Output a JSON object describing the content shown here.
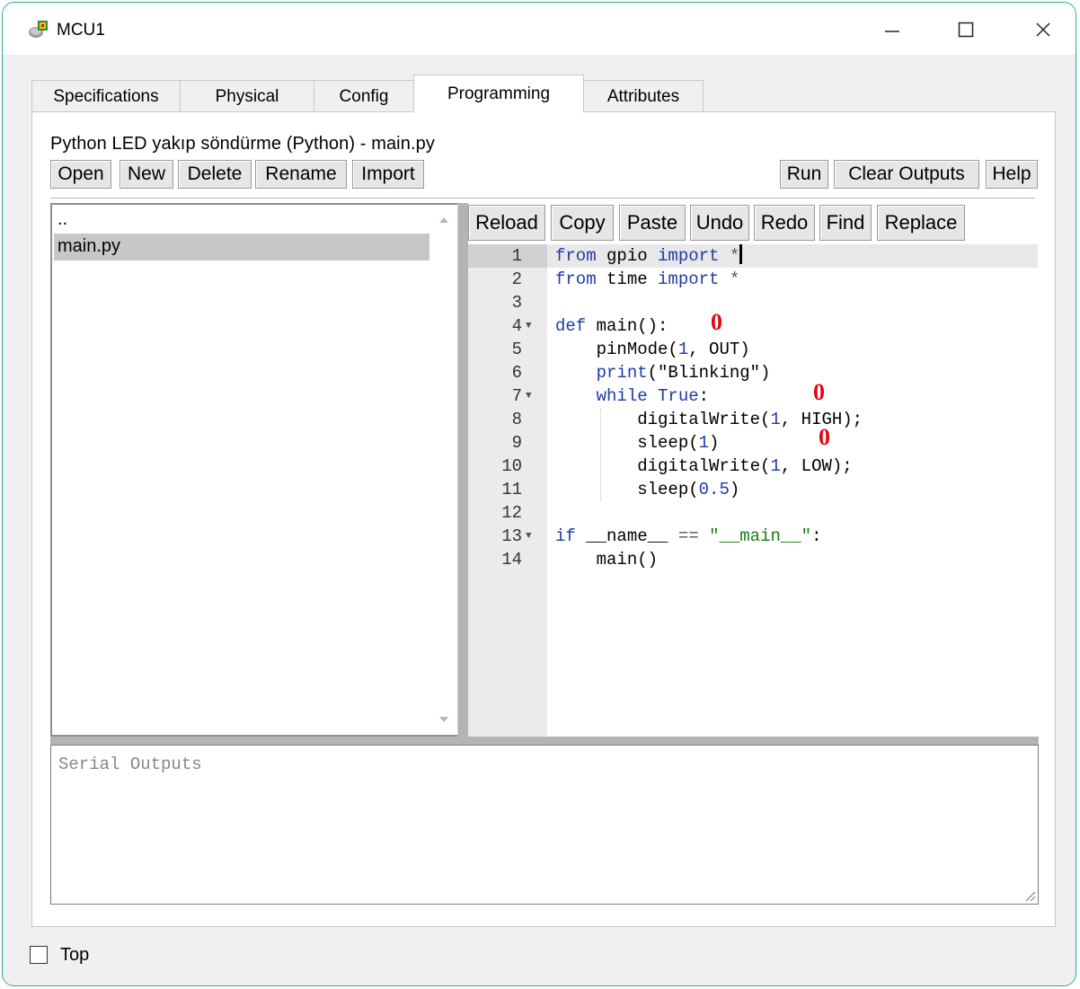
{
  "window": {
    "title": "MCU1",
    "icon": "mcu-device-icon",
    "controls": [
      "minimize-icon",
      "maximize-icon",
      "close-icon"
    ]
  },
  "tabs": [
    {
      "label": "Specifications",
      "active": false
    },
    {
      "label": "Physical",
      "active": false
    },
    {
      "label": "Config",
      "active": false
    },
    {
      "label": "Programming",
      "active": true
    },
    {
      "label": "Attributes",
      "active": false
    }
  ],
  "programming": {
    "file_title": "Python LED yakıp söndürme (Python) - main.py",
    "file_toolbar": [
      "Open",
      "New",
      "Delete",
      "Rename",
      "Import"
    ],
    "run_toolbar": [
      "Run",
      "Clear Outputs",
      "Help"
    ],
    "files": [
      {
        "name": "..",
        "selected": false
      },
      {
        "name": "main.py",
        "selected": true
      }
    ],
    "editor_toolbar": [
      "Reload",
      "Copy",
      "Paste",
      "Undo",
      "Redo",
      "Find",
      "Replace"
    ],
    "code_lines": [
      {
        "n": "1",
        "text": "from gpio import *"
      },
      {
        "n": "2",
        "text": "from time import *"
      },
      {
        "n": "3",
        "text": ""
      },
      {
        "n": "4",
        "text": "def main():"
      },
      {
        "n": "5",
        "text": "    pinMode(1, OUT)"
      },
      {
        "n": "6",
        "text": "    print(\"Blinking\")"
      },
      {
        "n": "7",
        "text": "    while True:"
      },
      {
        "n": "8",
        "text": "        digitalWrite(1, HIGH);"
      },
      {
        "n": "9",
        "text": "        sleep(1)"
      },
      {
        "n": "10",
        "text": "        digitalWrite(1, LOW);"
      },
      {
        "n": "11",
        "text": "        sleep(0.5)"
      },
      {
        "n": "12",
        "text": ""
      },
      {
        "n": "13",
        "text": "if __name__ == \"__main__\":"
      },
      {
        "n": "14",
        "text": "    main()"
      }
    ],
    "annotation_marks": [
      "0",
      "0",
      "0"
    ],
    "serial_placeholder": "Serial Outputs"
  },
  "footer": {
    "top_label": "Top",
    "top_checked": false
  },
  "colors": {
    "keyword": "#1f3ba8",
    "string": "#1a7a1a",
    "annotation": "#e30613"
  }
}
